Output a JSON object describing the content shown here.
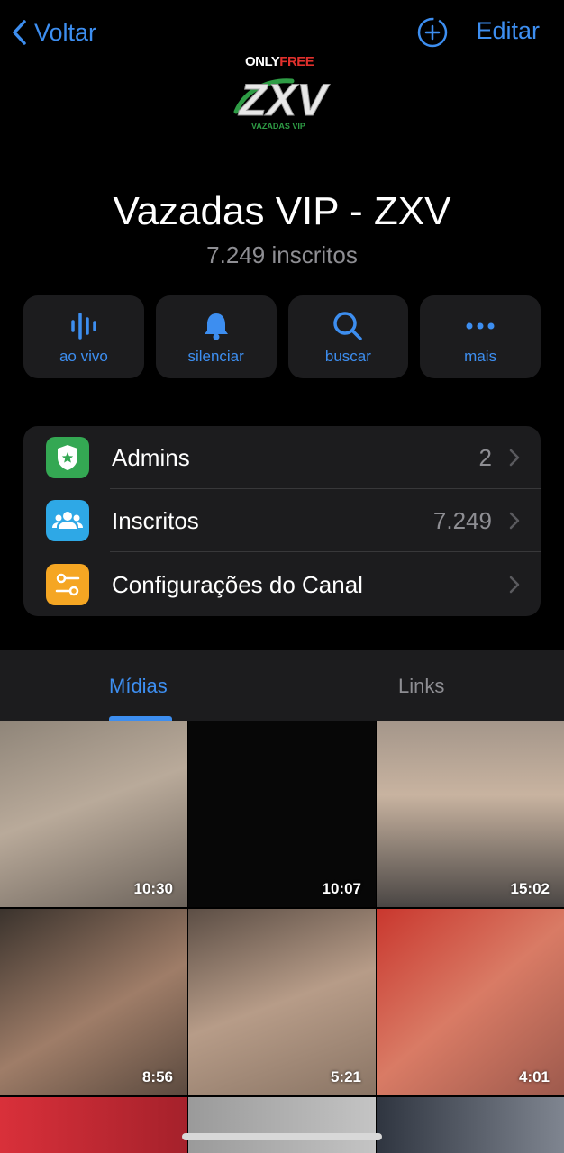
{
  "nav": {
    "back_label": "Voltar",
    "edit_label": "Editar"
  },
  "logo": {
    "top_only": "ONLY",
    "top_free": "FREE",
    "main": "ZXV",
    "sub": "VAZADAS VIP"
  },
  "channel": {
    "name": "Vazadas VIP - ZXV",
    "subscribers": "7.249 inscritos"
  },
  "actions": [
    {
      "label": "ao vivo",
      "icon": "live-waveform-icon"
    },
    {
      "label": "silenciar",
      "icon": "bell-icon"
    },
    {
      "label": "buscar",
      "icon": "search-icon"
    },
    {
      "label": "mais",
      "icon": "more-dots-icon"
    }
  ],
  "settings": [
    {
      "label": "Admins",
      "value": "2",
      "icon": "admin-badge-icon",
      "color": "#34a853"
    },
    {
      "label": "Inscritos",
      "value": "7.249",
      "icon": "subscribers-icon",
      "color": "#2ea8e6"
    },
    {
      "label": "Configurações do Canal",
      "value": "",
      "icon": "channel-settings-icon",
      "color": "#f5a623"
    }
  ],
  "tabs": {
    "media": "Mídias",
    "links": "Links"
  },
  "media": [
    {
      "duration": "10:30"
    },
    {
      "duration": "10:07"
    },
    {
      "duration": "15:02"
    },
    {
      "duration": "8:56"
    },
    {
      "duration": "5:21"
    },
    {
      "duration": "4:01"
    },
    {
      "duration": ""
    },
    {
      "duration": ""
    },
    {
      "duration": ""
    }
  ],
  "colors": {
    "accent": "#3d8ef0",
    "background": "#000000",
    "card": "#1c1c1e",
    "secondary_text": "#8e8e93"
  }
}
